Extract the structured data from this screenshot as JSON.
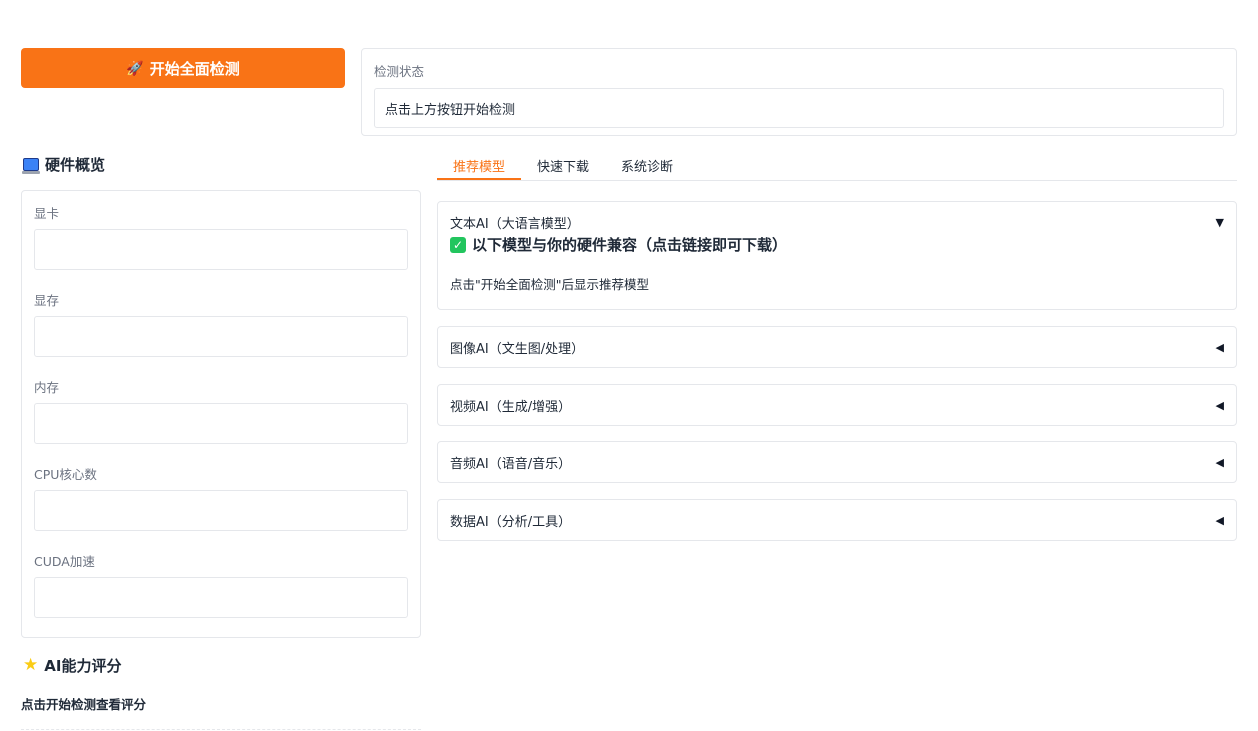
{
  "start_button": {
    "label": "开始全面检测",
    "icon": "rocket-icon"
  },
  "status": {
    "label": "检测状态",
    "value": "点击上方按钮开始检测"
  },
  "hardware": {
    "title": "硬件概览",
    "icon": "computer-icon",
    "fields": [
      {
        "label": "显卡",
        "value": ""
      },
      {
        "label": "显存",
        "value": ""
      },
      {
        "label": "内存",
        "value": ""
      },
      {
        "label": "CPU核心数",
        "value": ""
      },
      {
        "label": "CUDA加速",
        "value": ""
      }
    ]
  },
  "ai_score": {
    "title": "AI能力评分",
    "icon": "star-icon",
    "hint": "点击开始检测查看评分"
  },
  "tabs": [
    {
      "label": "推荐模型",
      "active": true
    },
    {
      "label": "快速下载",
      "active": false
    },
    {
      "label": "系统诊断",
      "active": false
    }
  ],
  "accordions": [
    {
      "title": "文本AI（大语言模型）",
      "expanded": true,
      "arrow": "▼",
      "compat_heading": "以下模型与你的硬件兼容（点击链接即可下载）",
      "note": "点击\"开始全面检测\"后显示推荐模型"
    },
    {
      "title": "图像AI（文生图/处理）",
      "expanded": false,
      "arrow": "◀"
    },
    {
      "title": "视频AI（生成/增强）",
      "expanded": false,
      "arrow": "◀"
    },
    {
      "title": "音频AI（语音/音乐）",
      "expanded": false,
      "arrow": "◀"
    },
    {
      "title": "数据AI（分析/工具）",
      "expanded": false,
      "arrow": "◀"
    }
  ],
  "colors": {
    "accent": "#f97316",
    "check": "#22c55e",
    "border": "#e5e7eb"
  }
}
